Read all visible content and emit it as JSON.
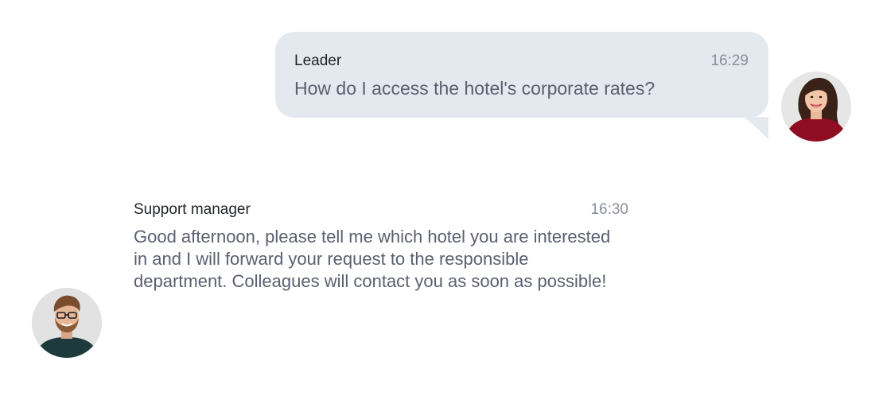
{
  "messages": {
    "outgoing": {
      "sender": "Leader",
      "time": "16:29",
      "text": "How do I access the hotel's corporate rates?"
    },
    "incoming": {
      "sender": "Support manager",
      "time": "16:30",
      "text": "Good afternoon, please tell me which hotel you are interested in and I will forward your request to the responsible department. Colleagues will contact you as soon as possible!"
    }
  },
  "colors": {
    "bubble": "#e4e8ef",
    "text": "#5a6070",
    "time": "#8a8f99"
  },
  "icons": {
    "leader_avatar": "avatar-woman",
    "support_avatar": "avatar-man"
  }
}
